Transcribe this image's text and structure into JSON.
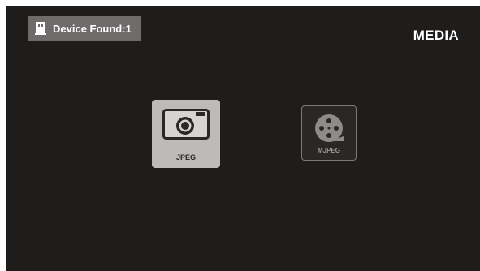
{
  "header": {
    "device_status": "Device Found:1",
    "device_icon": "usb-drive-icon",
    "section_title": "MEDIA"
  },
  "media_tiles": [
    {
      "label": "JPEG",
      "icon": "camera-icon",
      "selected": true
    },
    {
      "label": "MJPEG",
      "icon": "film-reel-icon",
      "selected": false
    }
  ],
  "colors": {
    "background": "#1f1c1c",
    "badge": "#6f6b6a",
    "selected_tile": "#bdbbba",
    "unselected_tile_border": "#7c7979",
    "text": "#ffffff"
  }
}
